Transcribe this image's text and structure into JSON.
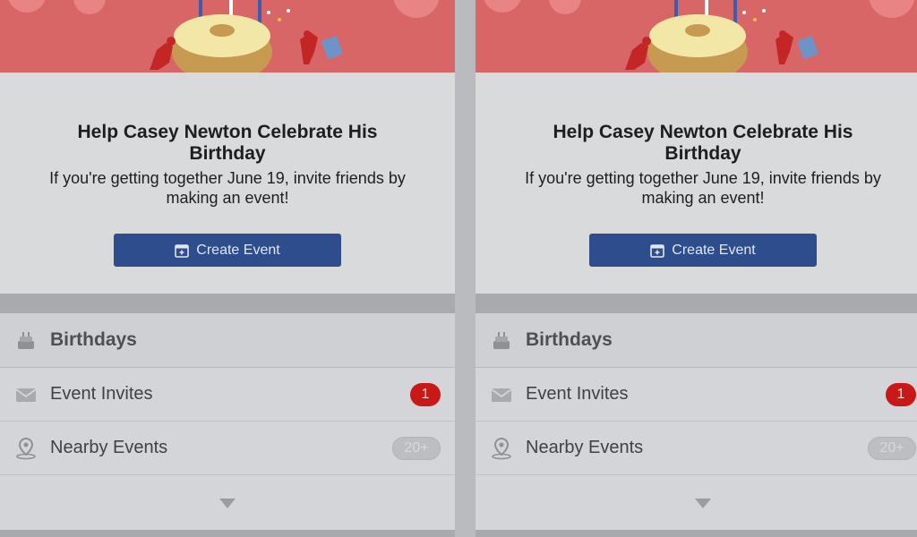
{
  "panels": [
    {
      "hero": {
        "title": "Help Casey Newton Celebrate His Birthday",
        "subtitle": "If you're getting together June 19, invite friends by making an event!",
        "button_label": "Create Event"
      },
      "section": {
        "label": "Birthdays",
        "icon": "birthday-cake-icon"
      },
      "rows": [
        {
          "label": "Event Invites",
          "icon": "envelope-icon",
          "badge": "1"
        },
        {
          "label": "Nearby Events",
          "icon": "location-pin-icon",
          "badge": "20+"
        }
      ]
    },
    {
      "hero": {
        "title": "Help Casey Newton Celebrate His Birthday",
        "subtitle": "If you're getting together June 19, invite friends by making an event!",
        "button_label": "Create Event"
      },
      "section": {
        "label": "Birthdays",
        "icon": "birthday-cake-icon"
      },
      "rows": [
        {
          "label": "Event Invites",
          "icon": "envelope-icon",
          "badge": "1"
        },
        {
          "label": "Nearby Events",
          "icon": "location-pin-icon",
          "badge": "20+"
        }
      ]
    }
  ],
  "colors": {
    "banner": "#d96666",
    "button": "#2d4d8c",
    "badge_alert": "#c91818"
  }
}
